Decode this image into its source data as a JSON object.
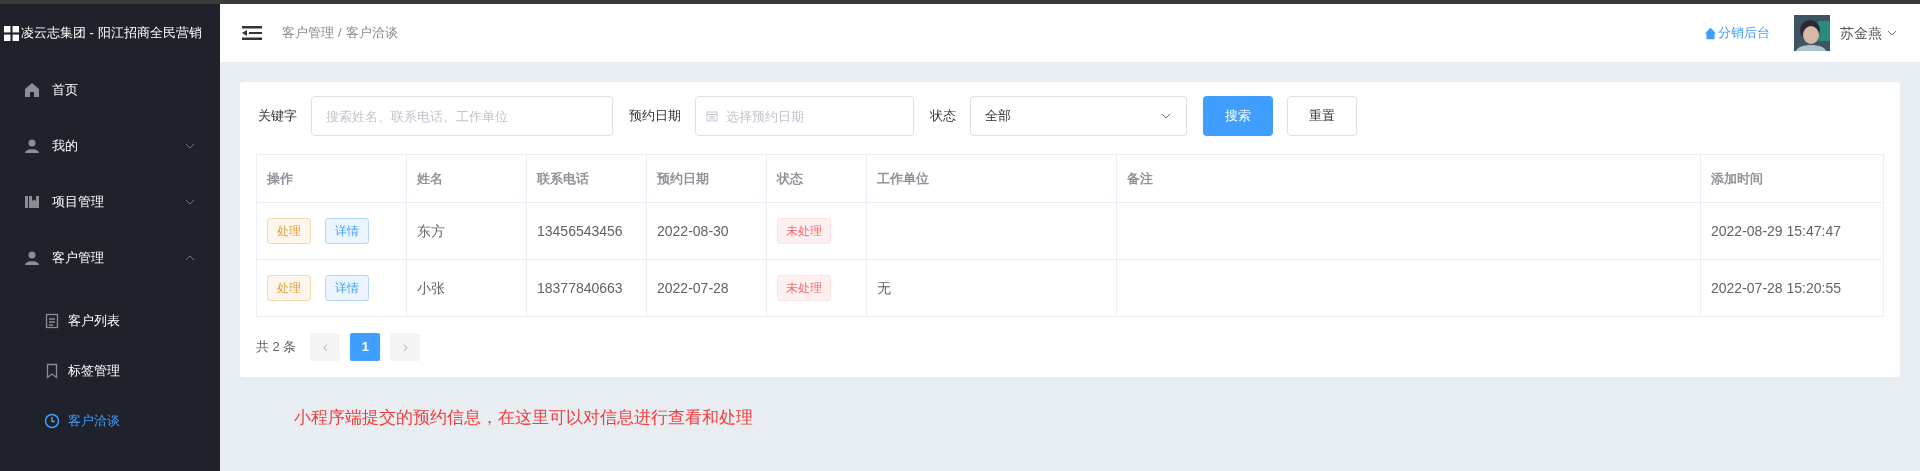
{
  "sidebar": {
    "title": "凌云志集团 - 阳江招商全民营销",
    "items": [
      {
        "label": "首页",
        "selected": false
      },
      {
        "label": "我的",
        "expanded": false,
        "selected": false
      },
      {
        "label": "项目管理",
        "expanded": false,
        "selected": false
      },
      {
        "label": "客户管理",
        "expanded": true,
        "selected": false,
        "children": [
          {
            "label": "客户列表",
            "selected": false
          },
          {
            "label": "标签管理",
            "selected": false
          },
          {
            "label": "客户洽谈",
            "selected": true
          }
        ]
      }
    ]
  },
  "header": {
    "breadcrumb": [
      "客户管理",
      "客户洽谈"
    ],
    "breadcrumb_separator": "/",
    "link": "分销后台",
    "user": "苏金燕"
  },
  "filters": [
    {
      "kind": "text",
      "label": "关键字",
      "placeholder": "搜索姓名、联系电话、工作单位"
    },
    {
      "kind": "date",
      "label": "预约日期",
      "placeholder": "选择预约日期"
    },
    {
      "kind": "select",
      "label": "状态",
      "value": "全部"
    }
  ],
  "buttons": [
    {
      "label": "搜索",
      "primary": true
    },
    {
      "label": "重置",
      "primary": false
    }
  ],
  "table": {
    "columns": [
      "操作",
      "姓名",
      "联系电话",
      "预约日期",
      "状态",
      "工作单位",
      "备注",
      "添加时间"
    ],
    "rows": [
      {
        "actions": [
          "处理",
          "详情"
        ],
        "name": "东方",
        "phone": "13456543456",
        "date": "2022-08-30",
        "status": "未处理",
        "unit": "",
        "added": "2022-08-29 15:47:47"
      },
      {
        "actions": [
          "处理",
          "详情"
        ],
        "name": "小张",
        "phone": "18377840663",
        "date": "2022-07-28",
        "status": "未处理",
        "unit": "无",
        "added": "2022-07-28 15:20:55"
      }
    ]
  },
  "pagination": {
    "total": "共 2 条",
    "prev": "‹",
    "next": "›",
    "pages": [
      {
        "label": "1",
        "selected": true
      }
    ]
  },
  "note": "小程序端提交的预约信息，在这里可以对信息进行查看和处理"
}
